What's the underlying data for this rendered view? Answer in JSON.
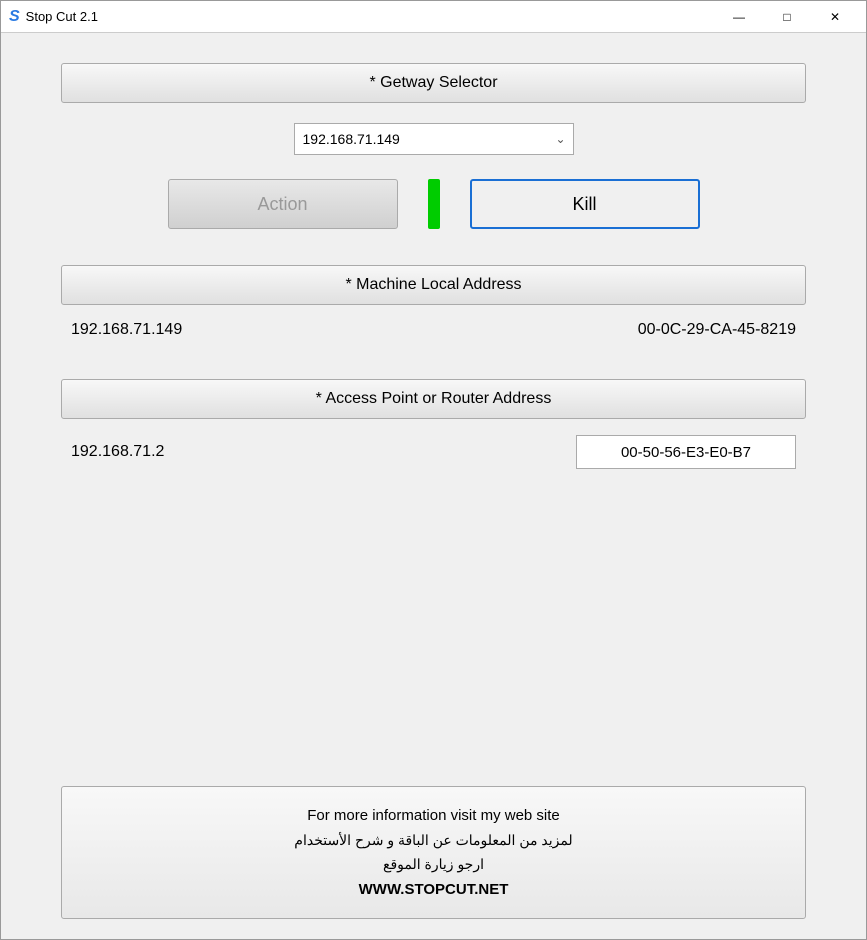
{
  "titlebar": {
    "icon": "S",
    "title": "Stop Cut 2.1",
    "minimize": "—",
    "maximize": "□",
    "close": "✕"
  },
  "gateway": {
    "header": "* Getway Selector",
    "dropdown_value": "192.168.71.149",
    "dropdown_options": [
      "192.168.71.149"
    ]
  },
  "action": {
    "action_label": "Action",
    "kill_label": "Kill"
  },
  "machine": {
    "header": "* Machine Local Address",
    "ip": "192.168.71.149",
    "mac": "00-0C-29-CA-45-8219"
  },
  "access": {
    "header": "* Access Point or Router Address",
    "ip": "192.168.71.2",
    "mac": "00-50-56-E3-E0-B7"
  },
  "footer": {
    "line1": "For more information visit my web site",
    "line2": "لمزيد من المعلومات عن الباقة و شرح الأستخدام",
    "line3": "ارجو زيارة الموقع",
    "line4": "WWW.STOPCUT.NET"
  }
}
